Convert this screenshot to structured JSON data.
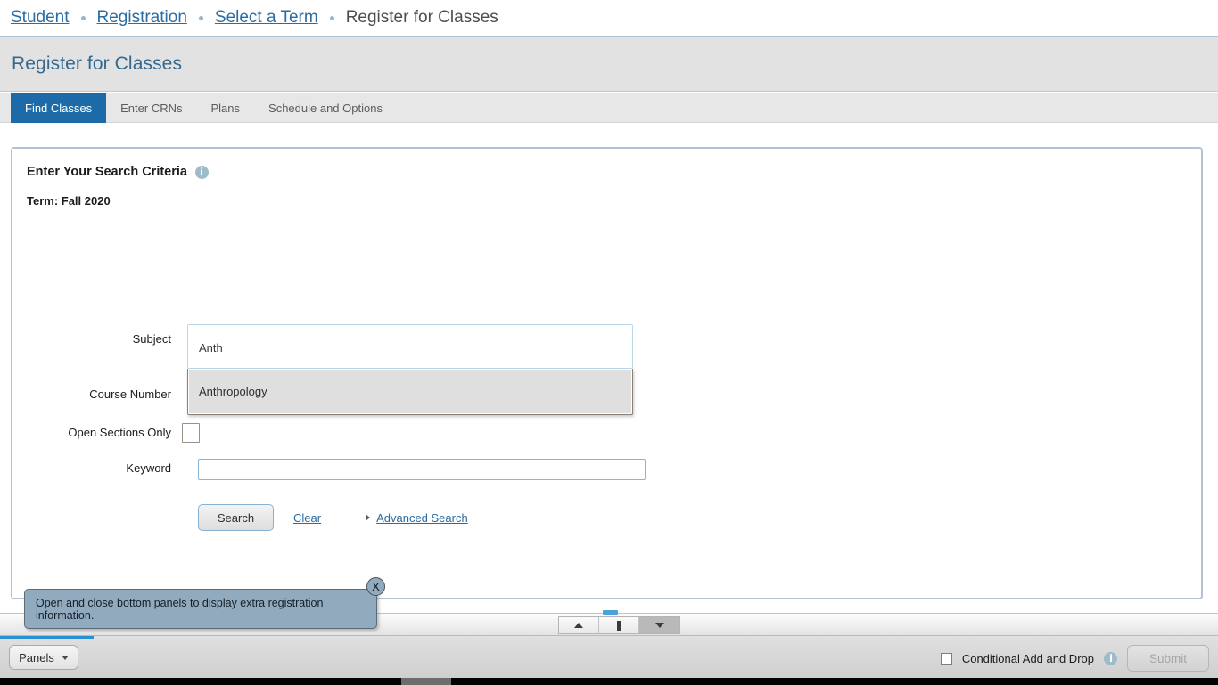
{
  "breadcrumb": {
    "items": [
      {
        "label": "Student",
        "current": false
      },
      {
        "label": "Registration",
        "current": false
      },
      {
        "label": "Select a Term",
        "current": false
      },
      {
        "label": "Register for Classes",
        "current": true
      }
    ]
  },
  "header": {
    "title": "Register for Classes"
  },
  "tabs": [
    {
      "label": "Find Classes",
      "active": true
    },
    {
      "label": "Enter CRNs",
      "active": false
    },
    {
      "label": "Plans",
      "active": false
    },
    {
      "label": "Schedule and Options",
      "active": false
    }
  ],
  "search_panel": {
    "heading": "Enter Your Search Criteria",
    "info_icon": "info-icon",
    "term_line": "Term: Fall 2020",
    "fields": {
      "subject": {
        "label": "Subject",
        "value": "Anth",
        "placeholder": "",
        "suggestions": [
          {
            "label": "Anthropology",
            "highlighted": true
          }
        ]
      },
      "course_number": {
        "label": "Course Number",
        "value": "",
        "placeholder": ""
      },
      "open_sections_only": {
        "label": "Open Sections Only",
        "checked": false
      },
      "keyword": {
        "label": "Keyword",
        "value": "",
        "placeholder": ""
      }
    },
    "actions": {
      "search_label": "Search",
      "clear_label": "Clear",
      "advanced_label": "Advanced Search",
      "advanced_expand_icon": "triangle-right-icon"
    }
  },
  "panel_divider": {
    "collapse_up_icon": "triangle-up-icon",
    "restore_icon": "pin-icon",
    "expand_down_icon": "triangle-down-icon"
  },
  "bottom_bar": {
    "panels_label": "Panels",
    "panels_caret_icon": "caret-down-icon",
    "conditional_label": "Conditional Add and Drop",
    "conditional_checked": false,
    "conditional_info_icon": "info-icon",
    "submit_label": "Submit",
    "submit_disabled": true
  },
  "callout": {
    "message": "Open and close bottom panels to display extra registration information.",
    "close_label": "X",
    "close_icon": "close-icon"
  },
  "colors": {
    "accent_blue": "#1c6ba8",
    "link_blue": "#2b6ca3",
    "title_blue": "#34688f",
    "title_band": "#e2e2e2",
    "card_border": "#b3c3d3",
    "callout_bg": "#91aabd",
    "suggestion_bg": "#dfdfdf"
  }
}
